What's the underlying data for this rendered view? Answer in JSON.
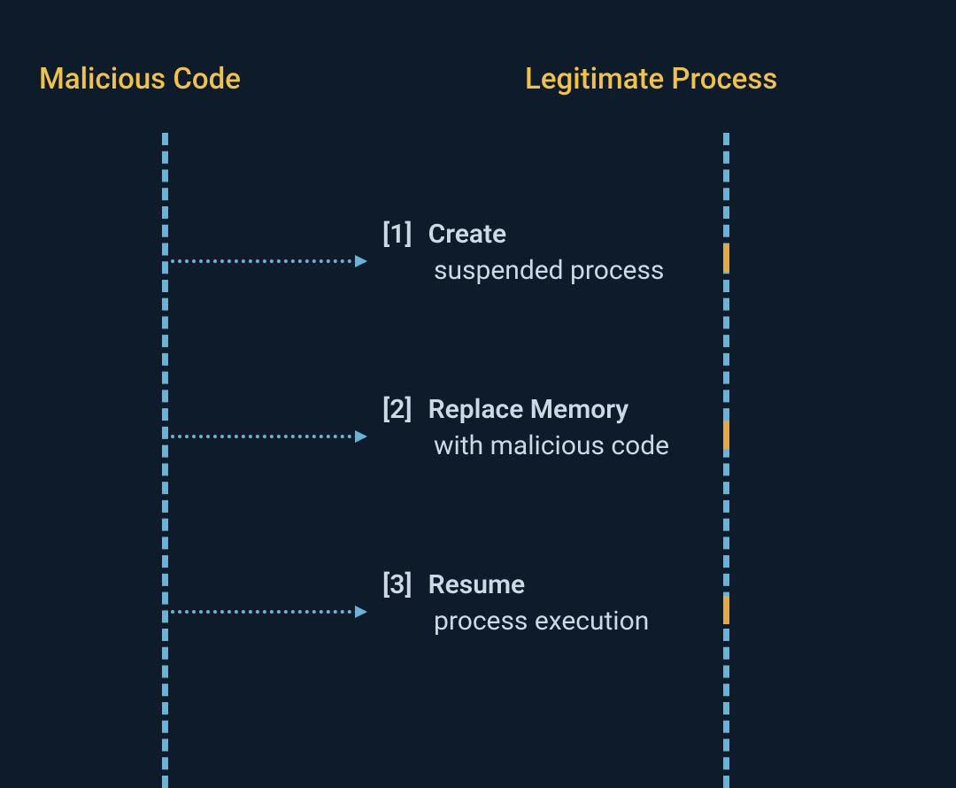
{
  "left_header": "Malicious Code",
  "right_header": "Legitimate Process",
  "steps": [
    {
      "num": "[1]",
      "title": "Create",
      "desc": "suspended process"
    },
    {
      "num": "[2]",
      "title": "Replace Memory",
      "desc": "with malicious code"
    },
    {
      "num": "[3]",
      "title": "Resume",
      "desc": "process execution"
    }
  ],
  "colors": {
    "background": "#0d1b2a",
    "heading": "#f0c14b",
    "lifeline": "#67b3d9",
    "text": "#cdd9e5",
    "marker": "#e6a840"
  }
}
